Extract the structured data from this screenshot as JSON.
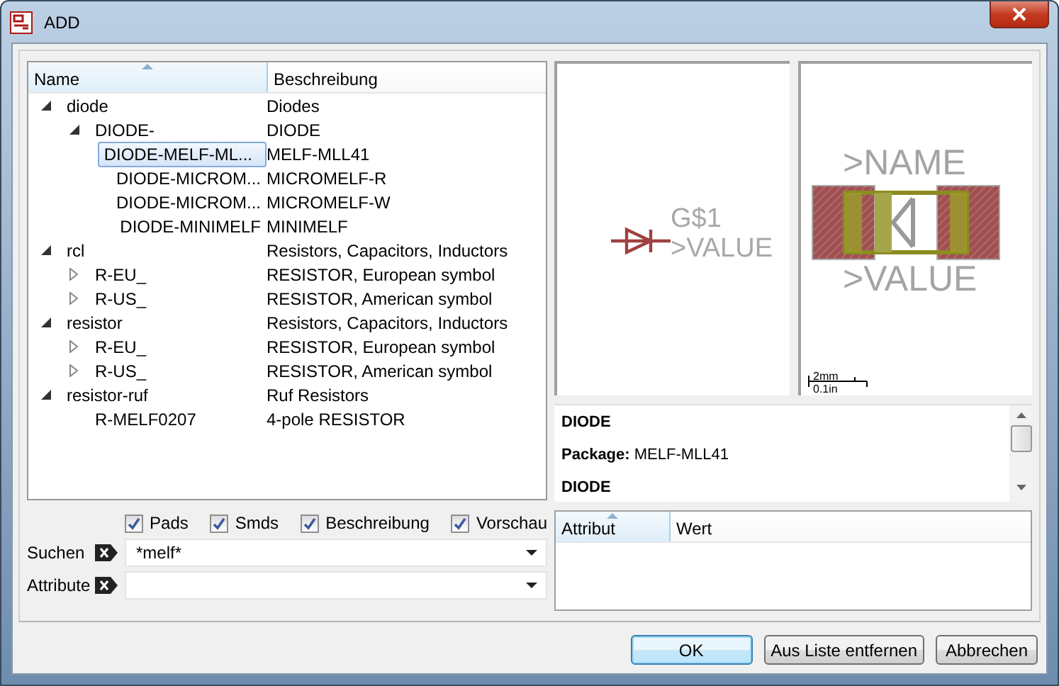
{
  "window": {
    "title": "ADD"
  },
  "tree": {
    "columns": [
      "Name",
      "Beschreibung"
    ],
    "rows": [
      {
        "name": "diode",
        "description": "Diodes",
        "expanded": true,
        "selected": false,
        "children": [
          {
            "name": "DIODE-",
            "description": "DIODE",
            "expanded": true,
            "selected": false,
            "children": [
              {
                "name": "DIODE-MELF-ML...",
                "description": "MELF-MLL41",
                "selected": true
              },
              {
                "name": "DIODE-MICROM...",
                "description": "MICROMELF-R",
                "selected": false
              },
              {
                "name": "DIODE-MICROM...",
                "description": "MICROMELF-W",
                "selected": false
              },
              {
                "name": "DIODE-MINIMELF",
                "description": "MINIMELF",
                "selected": false
              }
            ]
          }
        ]
      },
      {
        "name": "rcl",
        "description": "Resistors, Capacitors, Inductors",
        "expanded": true,
        "selected": false,
        "children": [
          {
            "name": "R-EU_",
            "description": "RESISTOR, European symbol",
            "expanded": false,
            "selected": false
          },
          {
            "name": "R-US_",
            "description": "RESISTOR, American symbol",
            "expanded": false,
            "selected": false
          }
        ]
      },
      {
        "name": "resistor",
        "description": "Resistors, Capacitors, Inductors",
        "expanded": true,
        "selected": false,
        "children": [
          {
            "name": "R-EU_",
            "description": "RESISTOR, European symbol",
            "expanded": false,
            "selected": false
          },
          {
            "name": "R-US_",
            "description": "RESISTOR, American symbol",
            "expanded": false,
            "selected": false
          }
        ]
      },
      {
        "name": "resistor-ruf",
        "description": "Ruf Resistors",
        "expanded": true,
        "selected": false,
        "children": [
          {
            "name": "R-MELF0207",
            "description": "4-pole RESISTOR",
            "selected": false
          }
        ]
      }
    ]
  },
  "options": [
    {
      "label": "Pads",
      "checked": true
    },
    {
      "label": "Smds",
      "checked": true
    },
    {
      "label": "Beschreibung",
      "checked": true
    },
    {
      "label": "Vorschau",
      "checked": true
    }
  ],
  "search": {
    "label": "Suchen",
    "value": "*melf*"
  },
  "attribute_filter": {
    "label": "Attribute"
  },
  "symbol_preview": {
    "name": "G$1",
    "value": ">VALUE"
  },
  "package_preview": {
    "name": ">NAME",
    "value": ">VALUE",
    "scale_top": "2mm",
    "scale_bottom": "0.1in"
  },
  "description": [
    {
      "kind": "heading",
      "text": "DIODE"
    },
    {
      "kind": "field",
      "text": "**Package:** MELF-MLL41"
    },
    {
      "kind": "heading",
      "text": "DIODE"
    }
  ],
  "attributes": {
    "columns": [
      "Attribut",
      "Wert"
    ]
  },
  "buttons": [
    {
      "label": "OK",
      "default": true
    },
    {
      "label": "Aus Liste entfernen",
      "default": false
    },
    {
      "label": "Abbrechen",
      "default": false
    }
  ]
}
